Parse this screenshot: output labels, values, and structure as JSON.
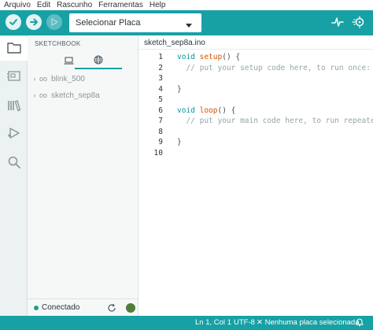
{
  "menu": [
    "Arquivo",
    "Edit",
    "Rascunho",
    "Ferramentas",
    "Help"
  ],
  "toolbar": {
    "board_select": "Selecionar Placa",
    "accent_color": "#17a1a5",
    "icons": [
      "verify-icon",
      "upload-icon",
      "debug-icon",
      "serial-plotter-icon",
      "serial-monitor-icon"
    ]
  },
  "rail": {
    "icons": [
      "sketchbook-folder-icon",
      "boards-manager-icon",
      "library-manager-icon",
      "debug-icon",
      "search-icon"
    ]
  },
  "sketchbook": {
    "title": "SKETCHBOOK",
    "tabs": [
      "local-icon",
      "cloud-icon"
    ],
    "items": [
      {
        "name": "blink_500"
      },
      {
        "name": "sketch_sep8a"
      }
    ],
    "footer_status": "Conectado"
  },
  "editor": {
    "tab_label": "sketch_sep8a.ino",
    "lines": [
      {
        "num": "1",
        "parts": [
          {
            "t": "void ",
            "c": "kw"
          },
          {
            "t": "setup",
            "c": "fn"
          },
          {
            "t": "() {",
            "c": ""
          }
        ]
      },
      {
        "num": "2",
        "parts": [
          {
            "t": "  // put your setup code here, to run once:",
            "c": "cm"
          }
        ]
      },
      {
        "num": "3",
        "parts": []
      },
      {
        "num": "4",
        "parts": [
          {
            "t": "}",
            "c": ""
          }
        ]
      },
      {
        "num": "5",
        "parts": []
      },
      {
        "num": "6",
        "parts": [
          {
            "t": "void ",
            "c": "kw"
          },
          {
            "t": "loop",
            "c": "fn"
          },
          {
            "t": "() {",
            "c": ""
          }
        ]
      },
      {
        "num": "7",
        "parts": [
          {
            "t": "  // put your main code here, to run repeated",
            "c": "cm"
          }
        ]
      },
      {
        "num": "8",
        "parts": []
      },
      {
        "num": "9",
        "parts": [
          {
            "t": "}",
            "c": ""
          }
        ]
      },
      {
        "num": "10",
        "parts": []
      }
    ]
  },
  "status": {
    "position": "Ln 1, Col 1",
    "encoding": "UTF-8",
    "board": "Nenhuma placa selecionada.",
    "bell_icon": "bell-icon"
  }
}
